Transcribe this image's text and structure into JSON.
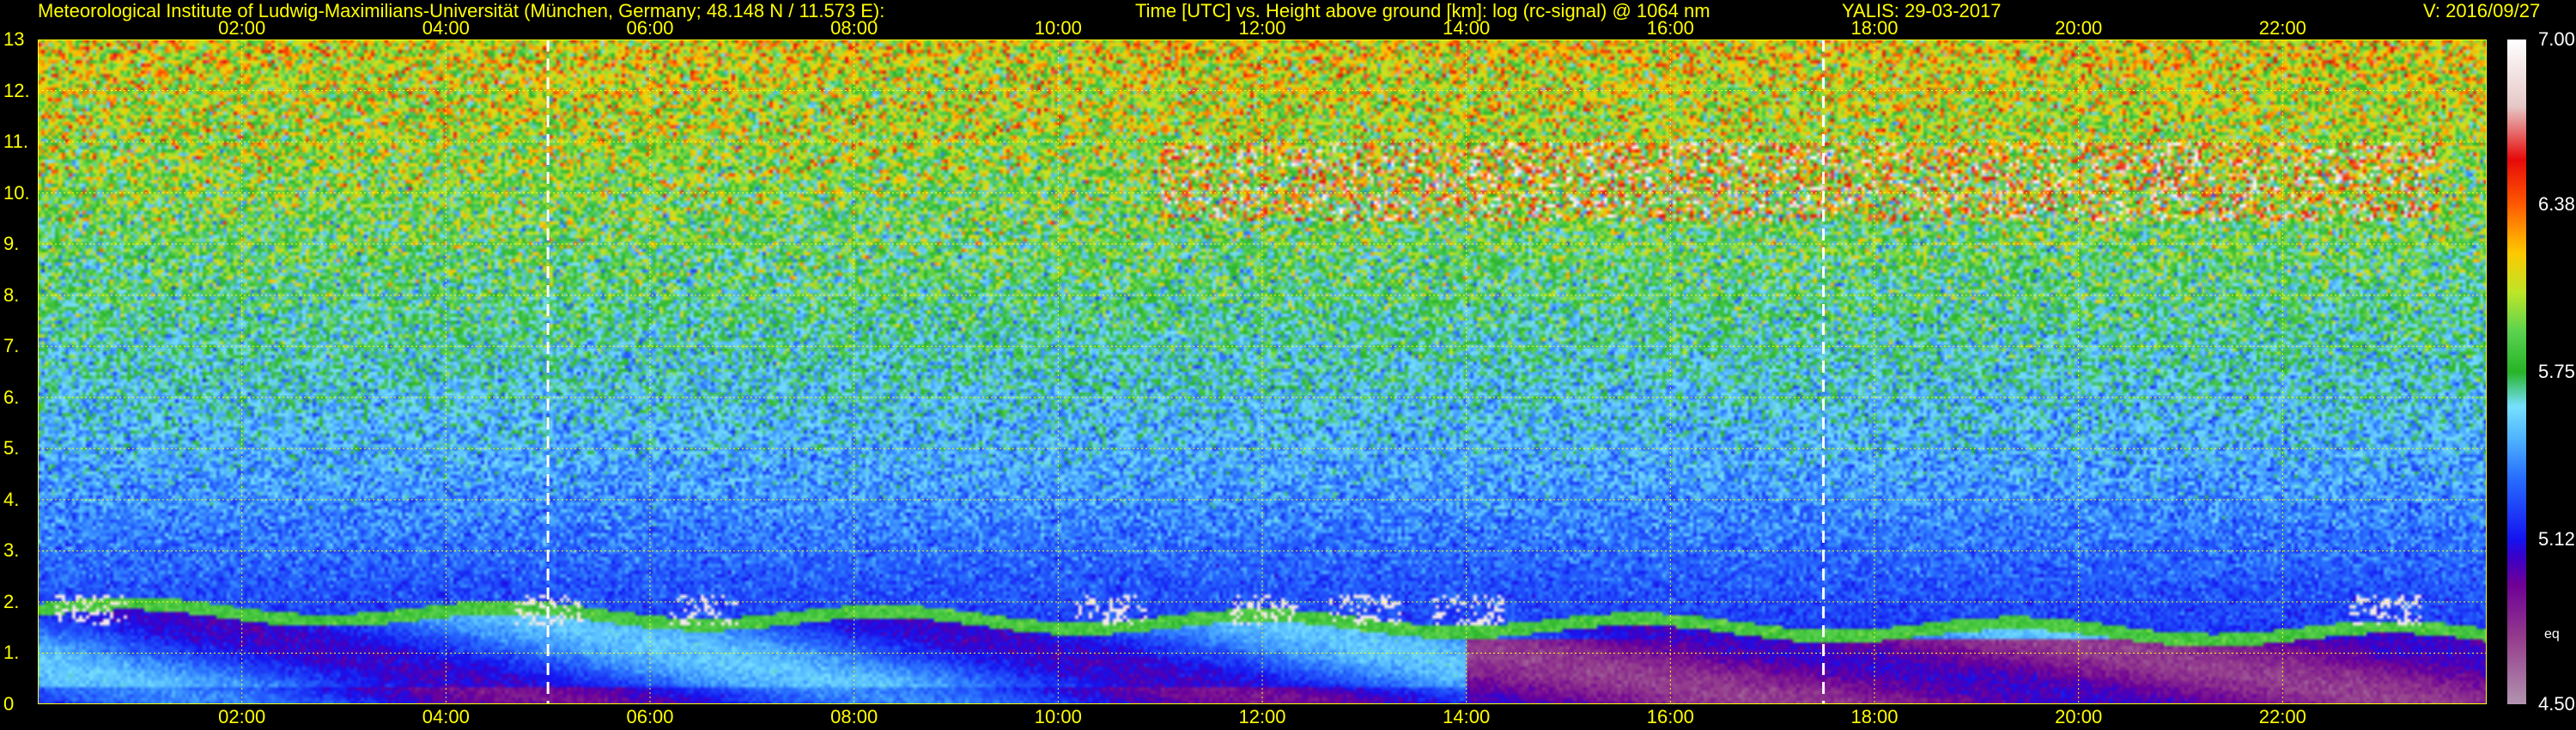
{
  "header": {
    "institute": "Meteorological Institute of Ludwig-Maximilians-Universität (München, Germany; 48.148 N / 11.573 E):",
    "plot_desc": "Time [UTC] vs. Height above ground [km]: log (rc-signal) @ 1064 nm",
    "station_date": "YALIS: 29-03-2017",
    "version": "V: 2016/09/27"
  },
  "colors": {
    "text": "#ffff00",
    "grid": "#ffff00",
    "marker": "#ffffff",
    "background": "#000000"
  },
  "chart_data": {
    "type": "heatmap",
    "title": "Time [UTC] vs. Height above ground [km]: log (rc-signal) @ 1064 nm",
    "xlabel": "Time [UTC]",
    "ylabel": "Height above ground [km]",
    "xlim": [
      "00:00",
      "24:00"
    ],
    "ylim": [
      0,
      13
    ],
    "x_ticks": [
      "02:00",
      "04:00",
      "06:00",
      "08:00",
      "10:00",
      "12:00",
      "14:00",
      "16:00",
      "18:00",
      "20:00",
      "22:00"
    ],
    "y_ticks": [
      "0",
      "1.",
      "2.",
      "3.",
      "4.",
      "5.",
      "6.",
      "7.",
      "8.",
      "9.",
      "10.",
      "11.",
      "12.",
      "13"
    ],
    "grid": true,
    "colorbar": {
      "range": [
        4.5,
        7.0
      ],
      "ticks": [
        "7.00",
        "6.38",
        "5.75",
        "5.12",
        "4.50"
      ],
      "label": "eq"
    },
    "vertical_markers_utc": [
      "05:00",
      "17:30"
    ],
    "features": [
      {
        "name": "boundary layer",
        "top_km_start": 2.0,
        "top_km_end": 1.5
      },
      {
        "name": "cirrus",
        "time_start": "11:00",
        "time_end": "23:30",
        "height_km": [
          9.5,
          11.0
        ]
      },
      {
        "name": "low clouds",
        "times": [
          "00:30",
          "05:00",
          "06:30",
          "10:30",
          "12:00",
          "13:00",
          "14:00",
          "23:00"
        ],
        "height_km": [
          1.6,
          3.0
        ]
      }
    ]
  }
}
